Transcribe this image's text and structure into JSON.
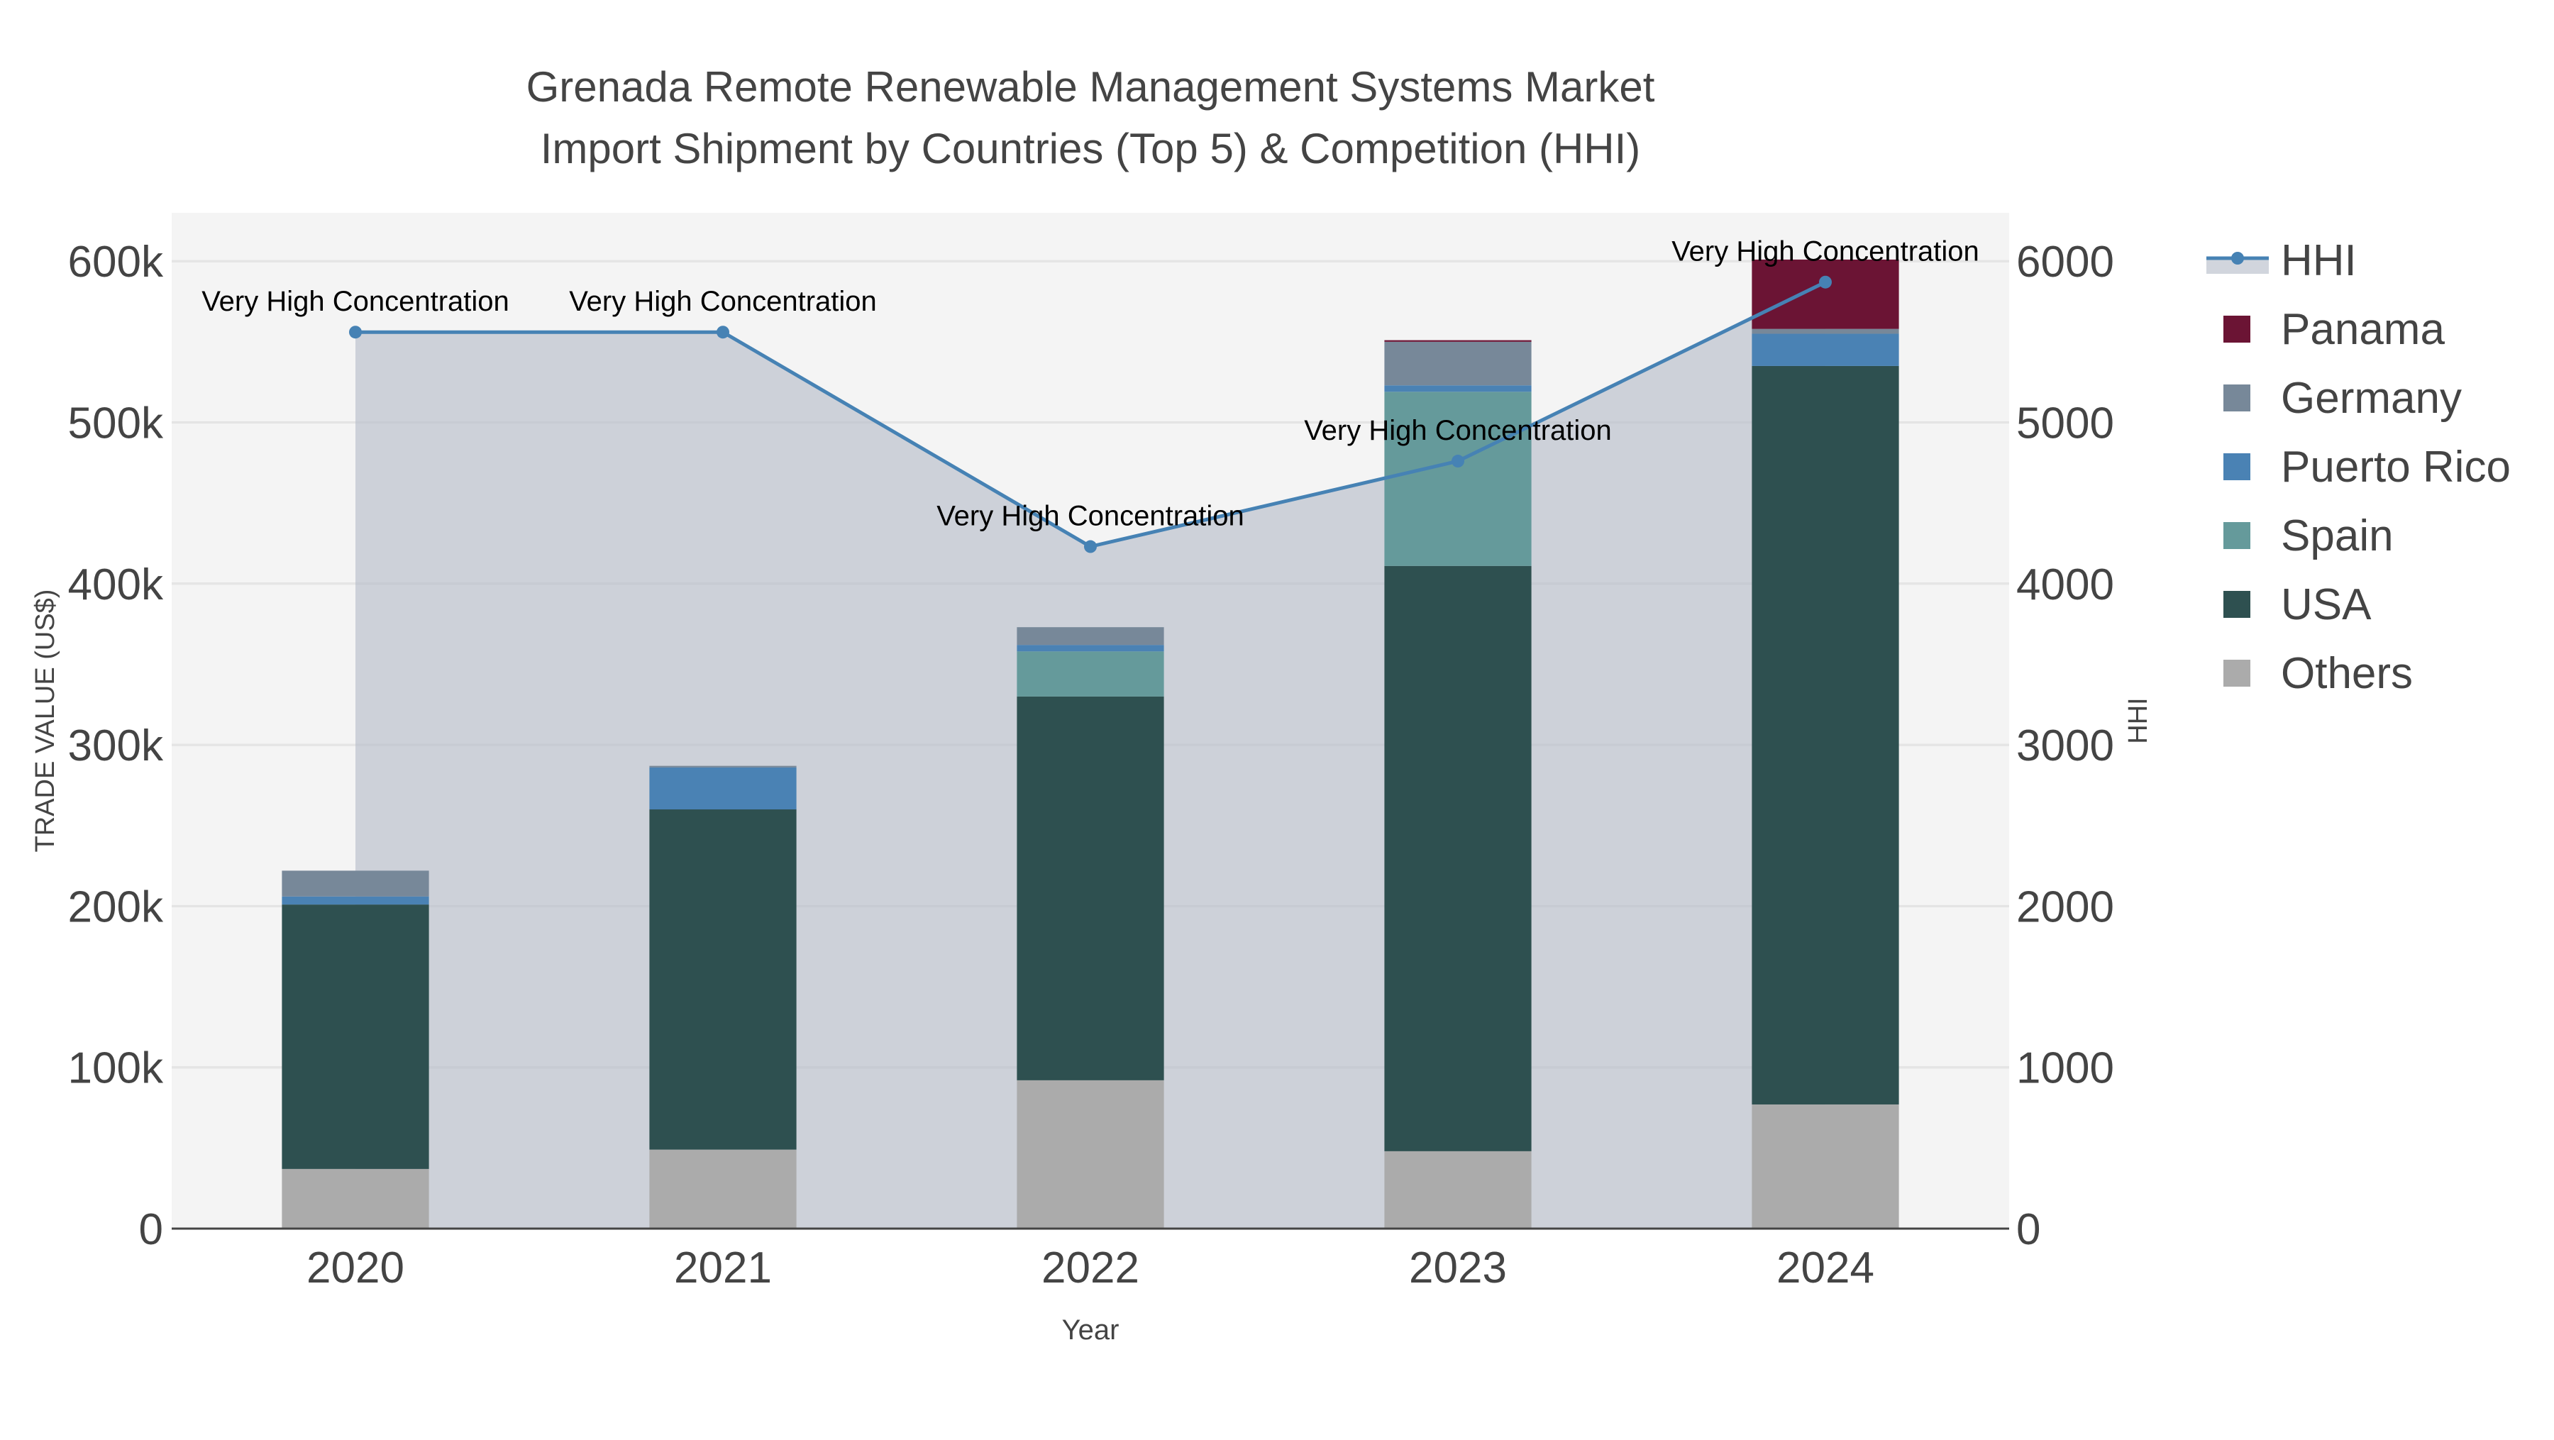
{
  "chart_data": {
    "type": "bar",
    "stacked": true,
    "title_line1": "Grenada Remote Renewable Management Systems Market",
    "title_line2": "Import Shipment by Countries (Top 5) & Competition (HHI)",
    "xlabel": "Year",
    "ylabel": "TRADE VALUE (US$)",
    "y2label": "HHI",
    "categories": [
      "2020",
      "2021",
      "2022",
      "2023",
      "2024"
    ],
    "ylim": [
      0,
      630000
    ],
    "y2lim": [
      0,
      6300
    ],
    "yticks": [
      0,
      100000,
      200000,
      300000,
      400000,
      500000,
      600000
    ],
    "ytick_labels": [
      "0",
      "100k",
      "200k",
      "300k",
      "400k",
      "500k",
      "600k"
    ],
    "y2ticks": [
      0,
      1000,
      2000,
      3000,
      4000,
      5000,
      6000
    ],
    "y2tick_labels": [
      "0",
      "1000",
      "2000",
      "3000",
      "4000",
      "5000",
      "6000"
    ],
    "grid": true,
    "legend_position": "right",
    "series": [
      {
        "name": "Others",
        "color": "#ababab",
        "values": [
          37000,
          49000,
          92000,
          48000,
          77000
        ]
      },
      {
        "name": "USA",
        "color": "#2e5050",
        "values": [
          164000,
          211000,
          238000,
          363000,
          458000
        ]
      },
      {
        "name": "Spain",
        "color": "#659a9b",
        "values": [
          0,
          0,
          28000,
          108000,
          0
        ]
      },
      {
        "name": "Puerto Rico",
        "color": "#4a82b4",
        "values": [
          5000,
          26000,
          4000,
          4000,
          20000
        ]
      },
      {
        "name": "Germany",
        "color": "#778899",
        "values": [
          16000,
          1000,
          11000,
          27000,
          3000
        ]
      },
      {
        "name": "Panama",
        "color": "#6b1434",
        "values": [
          0,
          0,
          0,
          1000,
          43000
        ]
      }
    ],
    "hhi": {
      "name": "HHI",
      "color": "#4682b4",
      "values": [
        5560,
        5560,
        4230,
        4760,
        5870
      ],
      "labels": [
        "Very High Concentration",
        "Very High Concentration",
        "Very High Concentration",
        "Very High Concentration",
        "Very High Concentration"
      ]
    },
    "legend_order": [
      "HHI",
      "Panama",
      "Germany",
      "Puerto Rico",
      "Spain",
      "USA",
      "Others"
    ]
  }
}
